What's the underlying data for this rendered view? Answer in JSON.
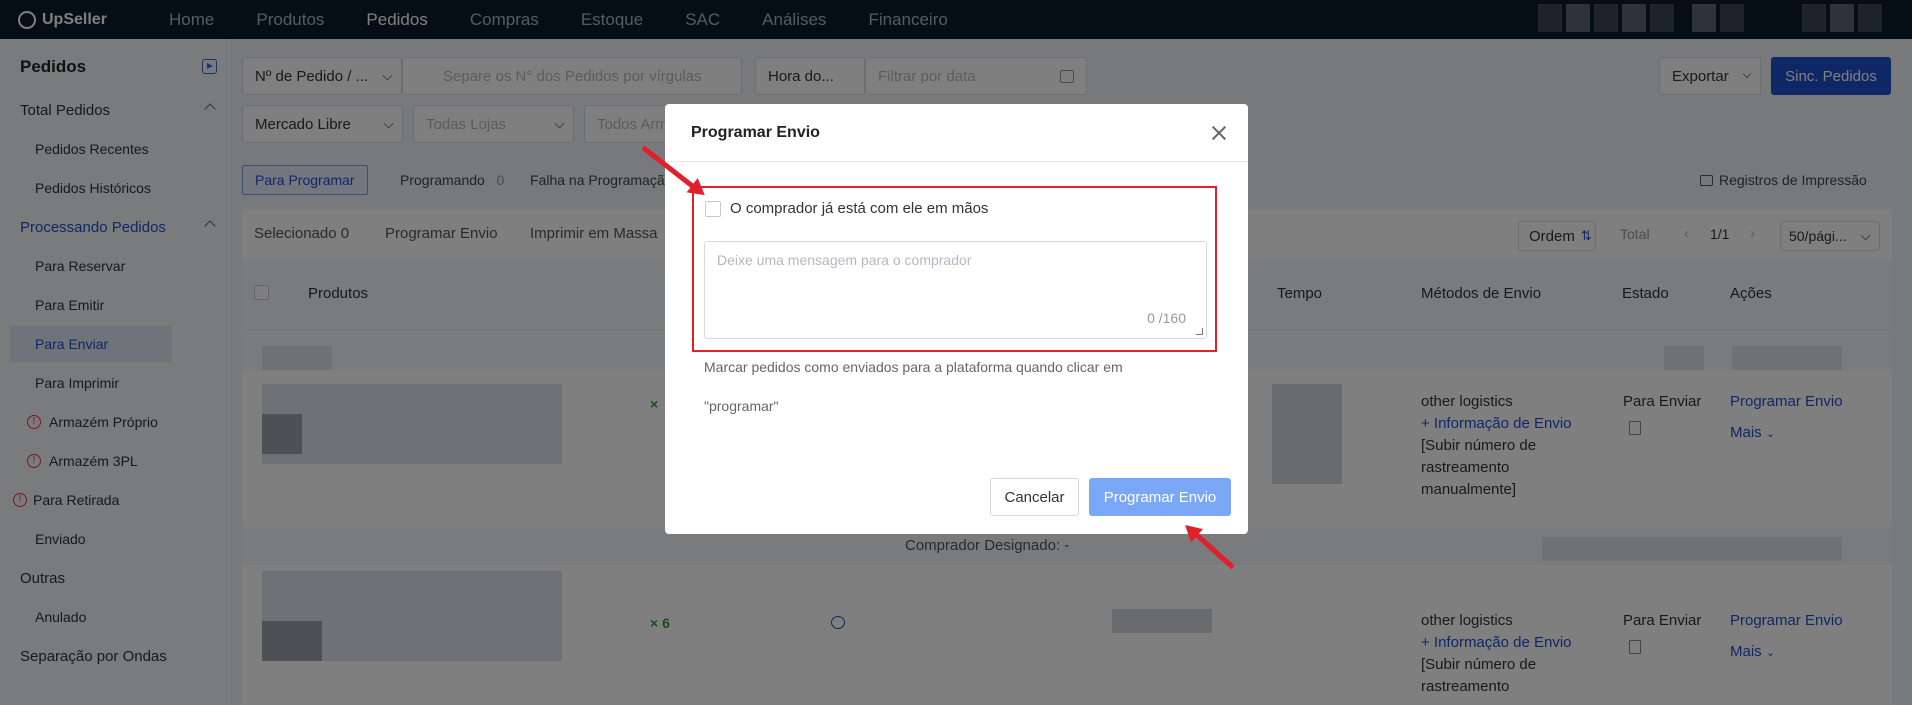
{
  "app": {
    "name": "UpSeller"
  },
  "nav": [
    "Home",
    "Produtos",
    "Pedidos",
    "Compras",
    "Estoque",
    "SAC",
    "Análises",
    "Financeiro"
  ],
  "sidebar": {
    "title": "Pedidos",
    "items": [
      {
        "label": "Total Pedidos"
      },
      {
        "label": "Pedidos Recentes"
      },
      {
        "label": "Pedidos Históricos"
      },
      {
        "label": "Processando Pedidos"
      },
      {
        "label": "Para Reservar"
      },
      {
        "label": "Para Emitir"
      },
      {
        "label": "Para Enviar"
      },
      {
        "label": "Para Imprimir"
      },
      {
        "label": "Armazém Próprio"
      },
      {
        "label": "Armazém 3PL"
      },
      {
        "label": "Para Retirada"
      },
      {
        "label": "Enviado"
      },
      {
        "label": "Outras"
      },
      {
        "label": "Anulado"
      },
      {
        "label": "Separação por Ondas"
      }
    ]
  },
  "filters": {
    "order_select": "Nº de Pedido / ...",
    "search_placeholder": "Separe os N° dos Pedidos por vírgulas",
    "time_select": "Hora do...",
    "date_placeholder": "Filtrar por data",
    "platform": "Mercado Libre",
    "stores": "Todas Lojas",
    "warehouses": "Todos Arm",
    "export": "Exportar",
    "sync": "Sinc. Pedidos"
  },
  "tabs": [
    {
      "label": "Para Programar"
    },
    {
      "label": "Programando",
      "count": "0"
    },
    {
      "label": "Falha na Programaçã"
    }
  ],
  "print_log": "Registros de Impressão",
  "toolbar": {
    "selected_label": "Selecionado",
    "selected_count": "0",
    "schedule": "Programar Envio",
    "print_bulk": "Imprimir em Massa",
    "sort": "Ordem",
    "total": "Total",
    "page": "1/1",
    "per_page": "50/pági..."
  },
  "columns": {
    "products": "Produtos",
    "time": "Tempo",
    "shipping": "Métodos de Envio",
    "status": "Estado",
    "actions": "Ações"
  },
  "rows": [
    {
      "qty": "×",
      "shipping": "other logistics",
      "info_link": "+ Informação de Envio",
      "note": "[Subir número de rastreamento manualmente]",
      "status": "Para Enviar",
      "action": "Programar Envio",
      "more": "Mais"
    },
    {
      "qty": "× 6",
      "shipping": "other logistics",
      "info_link": "+ Informação de Envio",
      "note": "[Subir número de rastreamento",
      "status": "Para Enviar",
      "action": "Programar Envio",
      "more": "Mais"
    }
  ],
  "buyer_label": "Comprador Designado: -",
  "modal": {
    "title": "Programar Envio",
    "checkbox_label": "O comprador já está com ele em mãos",
    "message_placeholder": "Deixe uma mensagem para o comprador",
    "char_count": "0 /160",
    "note_line1": "Marcar pedidos como enviados para a plataforma quando clicar em",
    "note_line2": "\"programar\"",
    "cancel": "Cancelar",
    "submit": "Programar Envio"
  },
  "colors": {
    "topbar": "#0a1a2e",
    "primary": "#1f4fcf",
    "highlight": "#e0202a"
  }
}
